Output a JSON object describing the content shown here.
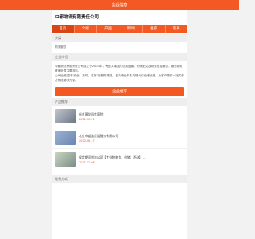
{
  "topbar": {
    "title": "企业信息"
  },
  "company": {
    "name": "中都物流有限责任公司"
  },
  "nav": {
    "items": [
      {
        "label": "首页"
      },
      {
        "label": "介绍"
      },
      {
        "label": "产品"
      },
      {
        "label": "新闻"
      },
      {
        "label": "推荐"
      },
      {
        "label": "联系"
      }
    ]
  },
  "category": {
    "title": "分类",
    "value": "物流服务"
  },
  "intro": {
    "title": "企业介绍",
    "p1": "中都物流有限责任公司成立于2003年，专业从事国内公路运输、仓储配送及物流信息服务，服务网络覆盖全国主要城市。",
    "p2": "公司始终坚持“安全、准时、高效”的服务理念，依托专业车队与现代化仓储设施，为客户提供一站式综合物流解决方案。"
  },
  "cta": {
    "label": "企业推荐"
  },
  "news": {
    "title": "产品推荐",
    "items": [
      {
        "title": "新乡黄龙园农家院",
        "date": "2022-10-21"
      },
      {
        "title": "北京市道路货运服务有限公司",
        "date": "2020-06-17"
      },
      {
        "title": "保定期间物流公司【专业物流包、仓储、配送】…",
        "date": "2017-12-08"
      }
    ]
  },
  "footer": {
    "title": "联系方式"
  }
}
